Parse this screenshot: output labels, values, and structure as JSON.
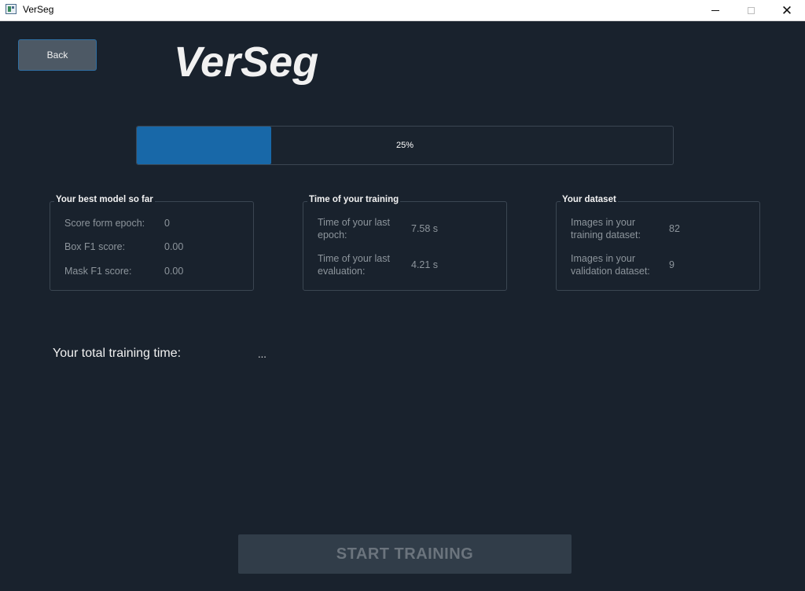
{
  "window": {
    "title": "VerSeg",
    "icon": "verseg-app-icon",
    "controls": {
      "minimize": "minimize-icon",
      "maximize": "maximize-icon",
      "close": "close-icon"
    }
  },
  "header": {
    "back_label": "Back",
    "app_title": "VerSeg"
  },
  "progress": {
    "value": 25,
    "text": "25%",
    "fill_color": "#1868a8"
  },
  "best_model": {
    "title": "Your best model so far",
    "rows": [
      {
        "label": "Score form epoch:",
        "value": "0"
      },
      {
        "label": "Box F1 score:",
        "value": "0.00"
      },
      {
        "label": "Mask F1 score:",
        "value": "0.00"
      }
    ]
  },
  "training_time": {
    "title": "Time of your training",
    "rows": [
      {
        "label_line1": "Time of your last",
        "label_line2": "epoch:",
        "value": "7.58 s"
      },
      {
        "label_line1": "Time of your last",
        "label_line2": "evaluation:",
        "value": "4.21 s"
      }
    ]
  },
  "dataset": {
    "title": "Your dataset",
    "rows": [
      {
        "label_line1": "Images in your",
        "label_line2": "training dataset:",
        "value": "82"
      },
      {
        "label_line1": "Images in your",
        "label_line2": "validation dataset:",
        "value": "9"
      }
    ]
  },
  "total": {
    "label": "Your total training time:",
    "value": "..."
  },
  "start_button": {
    "label": "START TRAINING"
  },
  "colors": {
    "background": "#19222d",
    "accent": "#1868a8",
    "button_disabled": "#313d49"
  }
}
